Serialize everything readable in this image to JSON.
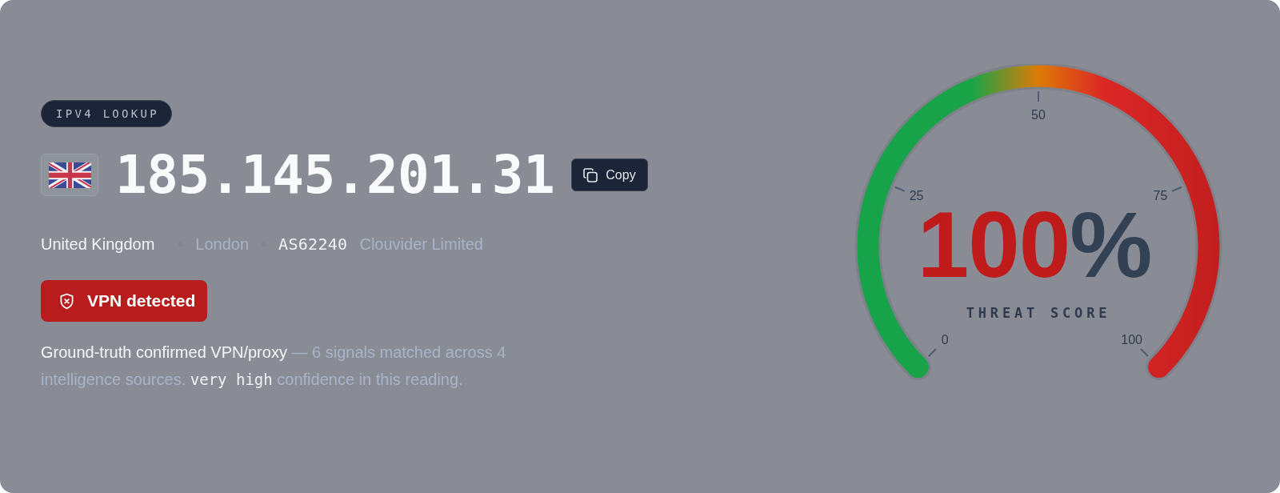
{
  "badge": "IPV4 LOOKUP",
  "ip": {
    "address": "185.145.201.31",
    "copy_button": "Copy"
  },
  "location": {
    "country": "United Kingdom",
    "city": "London",
    "asn": "AS62240",
    "organization": "Clouvider Limited"
  },
  "verdict": {
    "label": "VPN detected"
  },
  "summary": [
    {
      "kind": "lead",
      "text": "Ground-truth confirmed VPN/proxy"
    },
    {
      "kind": "plain",
      "text": "— 6 signals matched across 4 intelligence sources."
    },
    {
      "kind": "mono",
      "text": "very high"
    },
    {
      "kind": "plain",
      "text": "confidence in this reading."
    }
  ],
  "gauge": {
    "level": 1,
    "value": "100",
    "unit": "%",
    "label": "THREAT SCORE",
    "ticks": [
      "0",
      "25",
      "50",
      "75",
      "100"
    ]
  }
}
